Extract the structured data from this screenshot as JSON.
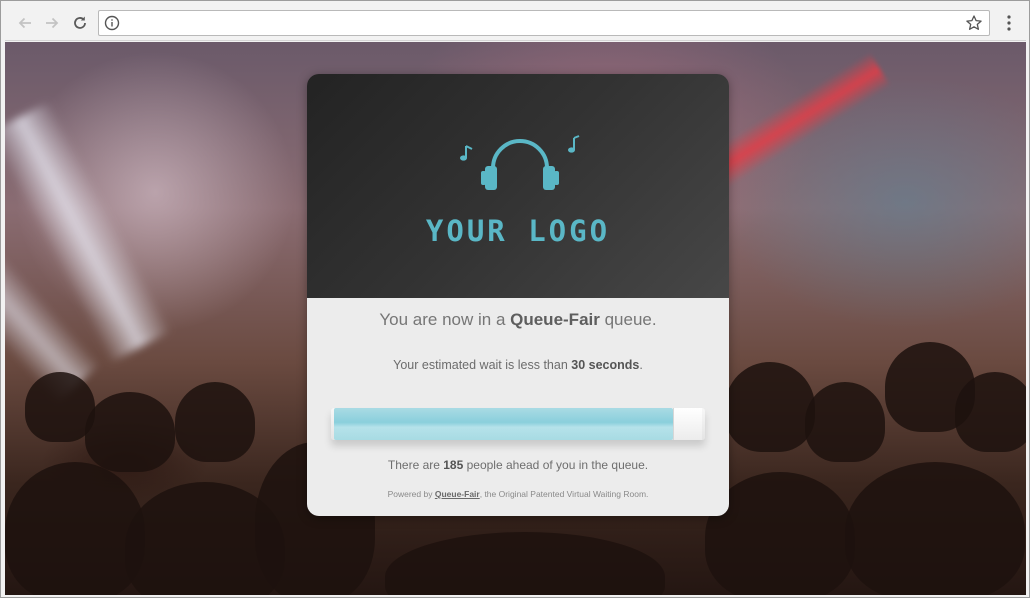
{
  "browser": {
    "url": "",
    "icons": {
      "back": "arrow-left-icon",
      "forward": "arrow-right-icon",
      "reload": "reload-icon",
      "info": "info-icon",
      "bookmark": "star-icon",
      "menu": "more-vert-icon"
    }
  },
  "card": {
    "logo_text": "YOUR LOGO",
    "logo_color": "#5ab7c6",
    "queue_prefix": "You are now in a ",
    "queue_name": "Queue-Fair",
    "queue_suffix": " queue.",
    "wait_prefix": "Your estimated wait is less than ",
    "wait_value": "30 seconds",
    "wait_suffix": ".",
    "progress_fraction": 0.92,
    "ahead_prefix": "There are ",
    "ahead_count": "185",
    "ahead_suffix": " people ahead of you in the queue.",
    "powered_prefix": "Powered by ",
    "powered_link": "Queue-Fair",
    "powered_suffix": ", the Original Patented Virtual Waiting Room."
  }
}
